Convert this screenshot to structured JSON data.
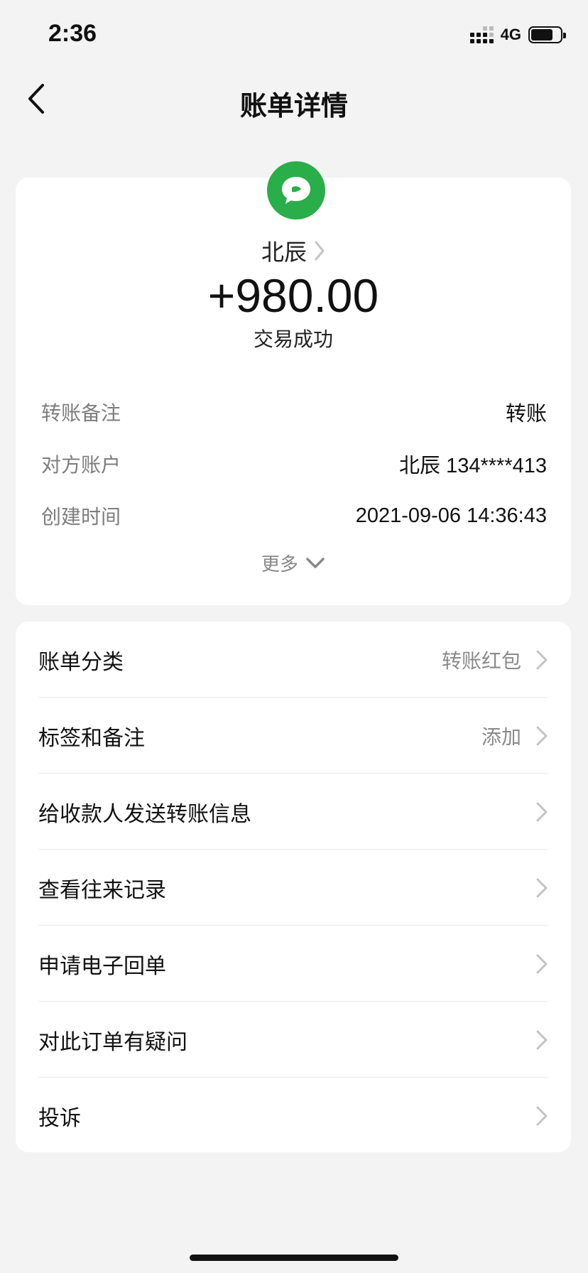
{
  "status_bar": {
    "time": "2:36",
    "network": "4G"
  },
  "header": {
    "title": "账单详情"
  },
  "transaction": {
    "counterparty": "北辰",
    "amount": "+980.00",
    "status": "交易成功",
    "details": [
      {
        "label": "转账备注",
        "value": "转账"
      },
      {
        "label": "对方账户",
        "value": "北辰 134****413"
      },
      {
        "label": "创建时间",
        "value": "2021-09-06 14:36:43"
      }
    ],
    "more_label": "更多"
  },
  "menu": {
    "items": [
      {
        "label": "账单分类",
        "value": "转账红包"
      },
      {
        "label": "标签和备注",
        "value": "添加"
      },
      {
        "label": "给收款人发送转账信息",
        "value": ""
      },
      {
        "label": "查看往来记录",
        "value": ""
      },
      {
        "label": "申请电子回单",
        "value": ""
      },
      {
        "label": "对此订单有疑问",
        "value": ""
      },
      {
        "label": "投诉",
        "value": ""
      }
    ]
  },
  "colors": {
    "accent_green": "#2aae4a",
    "background": "#f3f3f3",
    "card": "#ffffff"
  }
}
